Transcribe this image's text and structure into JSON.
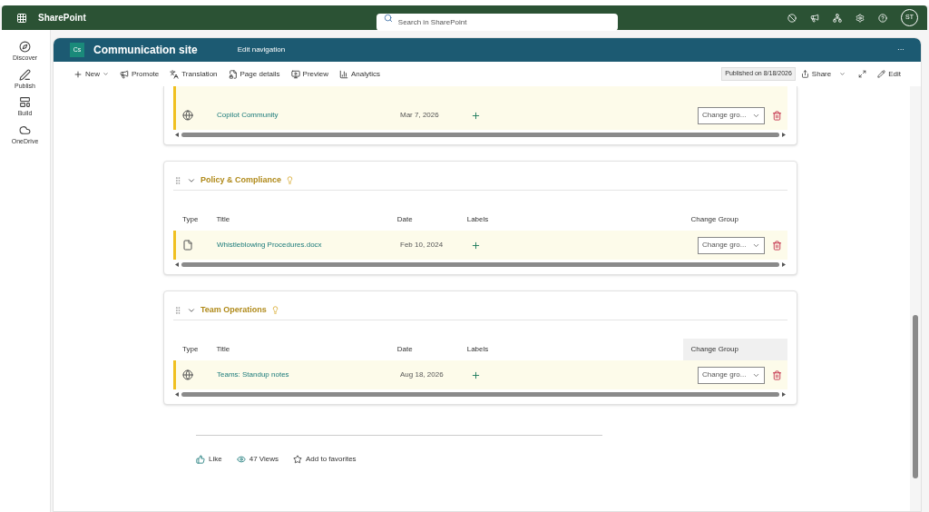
{
  "app_bar": {
    "brand": "SharePoint",
    "search": {
      "placeholder": "Search in SharePoint"
    },
    "avatar": "ST"
  },
  "rail": [
    {
      "label": "Discover"
    },
    {
      "label": "Publish"
    },
    {
      "label": "Build"
    },
    {
      "label": "OneDrive"
    }
  ],
  "site": {
    "logo": "Cs",
    "title": "Communication site",
    "nav": "Edit navigation",
    "more": "···"
  },
  "toolbar": {
    "actions": [
      {
        "label": "New",
        "caret": true
      },
      {
        "label": "Promote",
        "caret": false
      },
      {
        "label": "Translation",
        "caret": false
      },
      {
        "label": "Page details",
        "caret": false
      },
      {
        "label": "Preview",
        "caret": false
      },
      {
        "label": "Analytics",
        "caret": false
      }
    ],
    "published": "Published on 8/18/2026",
    "share": "Share",
    "edit": "Edit"
  },
  "groups": [
    {
      "rows": [
        {
          "kind": "web",
          "title": "Copilot Community",
          "date": "Mar 7, 2026",
          "select": "Change gro..."
        }
      ]
    },
    {
      "title": "Policy & Compliance",
      "columns": [
        {
          "label": "Type",
          "hovered": false
        },
        {
          "label": "Title",
          "hovered": false
        },
        {
          "label": "Date",
          "hovered": false
        },
        {
          "label": "Labels",
          "hovered": false
        },
        {
          "label": "Change Group",
          "hovered": false
        }
      ],
      "rows": [
        {
          "kind": "file",
          "title": "Whistleblowing Procedures.docx",
          "date": "Feb 10, 2024",
          "select": "Change gro..."
        }
      ]
    },
    {
      "title": "Team Operations",
      "columns": [
        {
          "label": "Type",
          "hovered": false
        },
        {
          "label": "Title",
          "hovered": false
        },
        {
          "label": "Date",
          "hovered": false
        },
        {
          "label": "Labels",
          "hovered": false
        },
        {
          "label": "Change Group",
          "hovered": true
        }
      ],
      "rows": [
        {
          "kind": "web",
          "title": "Teams: Standup notes",
          "date": "Aug 18, 2026",
          "select": "Change gro..."
        }
      ]
    }
  ],
  "footer": {
    "like": "Like",
    "views": "47 Views",
    "favorite": "Add to favorites"
  }
}
